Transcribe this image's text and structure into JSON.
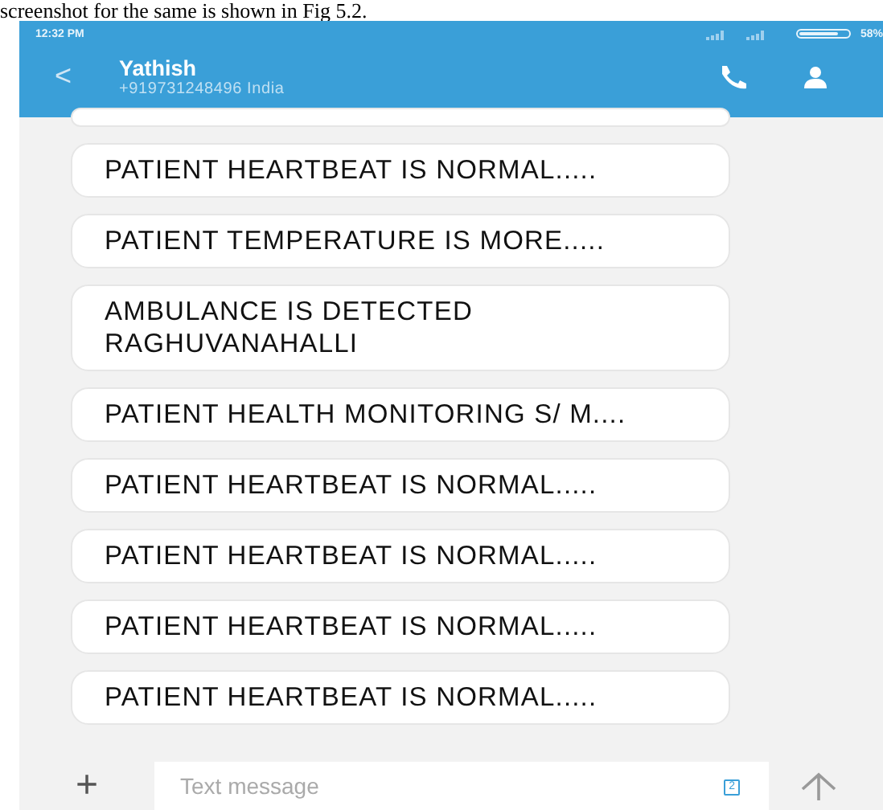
{
  "caption": "screenshot for the same is shown in Fig 5.2.",
  "status_bar": {
    "time": "12:32 PM",
    "battery": "58%"
  },
  "header": {
    "back": "<",
    "name": "Yathish",
    "number": "+919731248496 India"
  },
  "messages": [
    {
      "text": "PATIENT HEARTBEAT IS NORMAL....."
    },
    {
      "text": "PATIENT TEMPERATURE IS MORE....."
    },
    {
      "text": "AMBULANCE IS DETECTED RAGHUVANAHALLI"
    },
    {
      "text": "PATIENT HEALTH MONITORING S/ M...."
    },
    {
      "text": "PATIENT HEARTBEAT IS NORMAL....."
    },
    {
      "text": "PATIENT HEARTBEAT IS NORMAL....."
    },
    {
      "text": "PATIENT HEARTBEAT IS NORMAL....."
    },
    {
      "text": "PATIENT HEARTBEAT IS NORMAL....."
    }
  ],
  "compose": {
    "add": "+",
    "placeholder": "Text message",
    "sim": "2"
  }
}
